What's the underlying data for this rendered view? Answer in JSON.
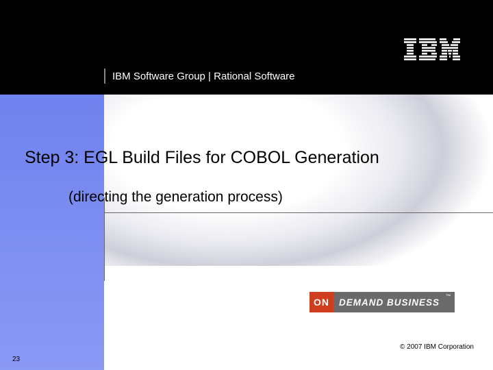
{
  "header": {
    "group_label": "IBM Software Group | Rational Software"
  },
  "title": "Step 3: EGL Build Files for COBOL Generation",
  "subtitle": "(directing the generation process)",
  "badge": {
    "on": "ON",
    "rest": "DEMAND BUSINESS",
    "tm": "™"
  },
  "copyright": "© 2007 IBM Corporation",
  "page_number": "23"
}
